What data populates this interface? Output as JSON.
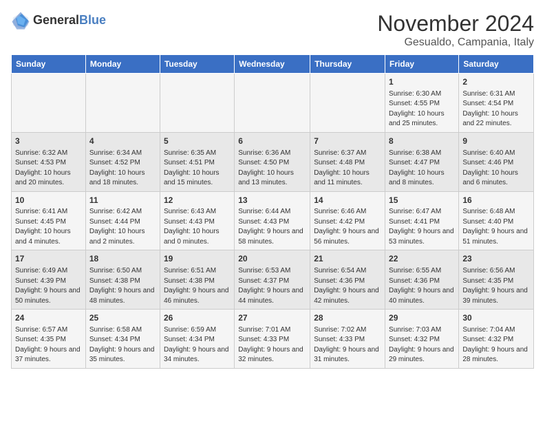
{
  "logo": {
    "general": "General",
    "blue": "Blue"
  },
  "title": "November 2024",
  "location": "Gesualdo, Campania, Italy",
  "weekdays": [
    "Sunday",
    "Monday",
    "Tuesday",
    "Wednesday",
    "Thursday",
    "Friday",
    "Saturday"
  ],
  "weeks": [
    [
      {
        "day": "",
        "info": ""
      },
      {
        "day": "",
        "info": ""
      },
      {
        "day": "",
        "info": ""
      },
      {
        "day": "",
        "info": ""
      },
      {
        "day": "",
        "info": ""
      },
      {
        "day": "1",
        "info": "Sunrise: 6:30 AM\nSunset: 4:55 PM\nDaylight: 10 hours and 25 minutes."
      },
      {
        "day": "2",
        "info": "Sunrise: 6:31 AM\nSunset: 4:54 PM\nDaylight: 10 hours and 22 minutes."
      }
    ],
    [
      {
        "day": "3",
        "info": "Sunrise: 6:32 AM\nSunset: 4:53 PM\nDaylight: 10 hours and 20 minutes."
      },
      {
        "day": "4",
        "info": "Sunrise: 6:34 AM\nSunset: 4:52 PM\nDaylight: 10 hours and 18 minutes."
      },
      {
        "day": "5",
        "info": "Sunrise: 6:35 AM\nSunset: 4:51 PM\nDaylight: 10 hours and 15 minutes."
      },
      {
        "day": "6",
        "info": "Sunrise: 6:36 AM\nSunset: 4:50 PM\nDaylight: 10 hours and 13 minutes."
      },
      {
        "day": "7",
        "info": "Sunrise: 6:37 AM\nSunset: 4:48 PM\nDaylight: 10 hours and 11 minutes."
      },
      {
        "day": "8",
        "info": "Sunrise: 6:38 AM\nSunset: 4:47 PM\nDaylight: 10 hours and 8 minutes."
      },
      {
        "day": "9",
        "info": "Sunrise: 6:40 AM\nSunset: 4:46 PM\nDaylight: 10 hours and 6 minutes."
      }
    ],
    [
      {
        "day": "10",
        "info": "Sunrise: 6:41 AM\nSunset: 4:45 PM\nDaylight: 10 hours and 4 minutes."
      },
      {
        "day": "11",
        "info": "Sunrise: 6:42 AM\nSunset: 4:44 PM\nDaylight: 10 hours and 2 minutes."
      },
      {
        "day": "12",
        "info": "Sunrise: 6:43 AM\nSunset: 4:43 PM\nDaylight: 10 hours and 0 minutes."
      },
      {
        "day": "13",
        "info": "Sunrise: 6:44 AM\nSunset: 4:43 PM\nDaylight: 9 hours and 58 minutes."
      },
      {
        "day": "14",
        "info": "Sunrise: 6:46 AM\nSunset: 4:42 PM\nDaylight: 9 hours and 56 minutes."
      },
      {
        "day": "15",
        "info": "Sunrise: 6:47 AM\nSunset: 4:41 PM\nDaylight: 9 hours and 53 minutes."
      },
      {
        "day": "16",
        "info": "Sunrise: 6:48 AM\nSunset: 4:40 PM\nDaylight: 9 hours and 51 minutes."
      }
    ],
    [
      {
        "day": "17",
        "info": "Sunrise: 6:49 AM\nSunset: 4:39 PM\nDaylight: 9 hours and 50 minutes."
      },
      {
        "day": "18",
        "info": "Sunrise: 6:50 AM\nSunset: 4:38 PM\nDaylight: 9 hours and 48 minutes."
      },
      {
        "day": "19",
        "info": "Sunrise: 6:51 AM\nSunset: 4:38 PM\nDaylight: 9 hours and 46 minutes."
      },
      {
        "day": "20",
        "info": "Sunrise: 6:53 AM\nSunset: 4:37 PM\nDaylight: 9 hours and 44 minutes."
      },
      {
        "day": "21",
        "info": "Sunrise: 6:54 AM\nSunset: 4:36 PM\nDaylight: 9 hours and 42 minutes."
      },
      {
        "day": "22",
        "info": "Sunrise: 6:55 AM\nSunset: 4:36 PM\nDaylight: 9 hours and 40 minutes."
      },
      {
        "day": "23",
        "info": "Sunrise: 6:56 AM\nSunset: 4:35 PM\nDaylight: 9 hours and 39 minutes."
      }
    ],
    [
      {
        "day": "24",
        "info": "Sunrise: 6:57 AM\nSunset: 4:35 PM\nDaylight: 9 hours and 37 minutes."
      },
      {
        "day": "25",
        "info": "Sunrise: 6:58 AM\nSunset: 4:34 PM\nDaylight: 9 hours and 35 minutes."
      },
      {
        "day": "26",
        "info": "Sunrise: 6:59 AM\nSunset: 4:34 PM\nDaylight: 9 hours and 34 minutes."
      },
      {
        "day": "27",
        "info": "Sunrise: 7:01 AM\nSunset: 4:33 PM\nDaylight: 9 hours and 32 minutes."
      },
      {
        "day": "28",
        "info": "Sunrise: 7:02 AM\nSunset: 4:33 PM\nDaylight: 9 hours and 31 minutes."
      },
      {
        "day": "29",
        "info": "Sunrise: 7:03 AM\nSunset: 4:32 PM\nDaylight: 9 hours and 29 minutes."
      },
      {
        "day": "30",
        "info": "Sunrise: 7:04 AM\nSunset: 4:32 PM\nDaylight: 9 hours and 28 minutes."
      }
    ]
  ]
}
